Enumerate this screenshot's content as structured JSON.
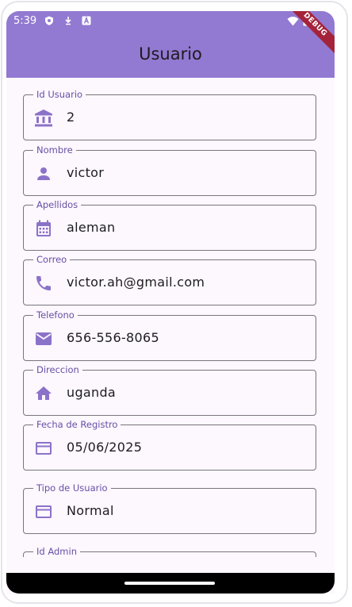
{
  "status_bar": {
    "time": "5:39",
    "icons": [
      "shield-icon",
      "download-icon",
      "a-icon",
      "wifi-icon",
      "battery-icon"
    ]
  },
  "appbar": {
    "title": "Usuario",
    "debug_banner": "DEBUG"
  },
  "colors": {
    "appbar": "#9279d1",
    "icon": "#8b72c9",
    "label": "#6750a4",
    "background": "#fdf7fe",
    "debug": "#a4233b"
  },
  "fields": [
    {
      "label": "Id Usuario",
      "value": "2",
      "icon": "bank-icon"
    },
    {
      "label": "Nombre",
      "value": "victor",
      "icon": "person-icon"
    },
    {
      "label": "Apellidos",
      "value": "aleman",
      "icon": "calendar-icon"
    },
    {
      "label": "Correo",
      "value": "victor.ah@gmail.com",
      "icon": "phone-icon"
    },
    {
      "label": "Telefono",
      "value": "656-556-8065",
      "icon": "email-icon"
    },
    {
      "label": "Direccion",
      "value": "uganda",
      "icon": "home-icon"
    },
    {
      "label": "Fecha de Registro",
      "value": "05/06/2025",
      "icon": "credit-card-icon"
    },
    {
      "label": "Tipo de Usuario",
      "value": "Normal",
      "icon": "credit-card-icon"
    },
    {
      "label": "Id Admin",
      "value": "",
      "icon": ""
    }
  ]
}
